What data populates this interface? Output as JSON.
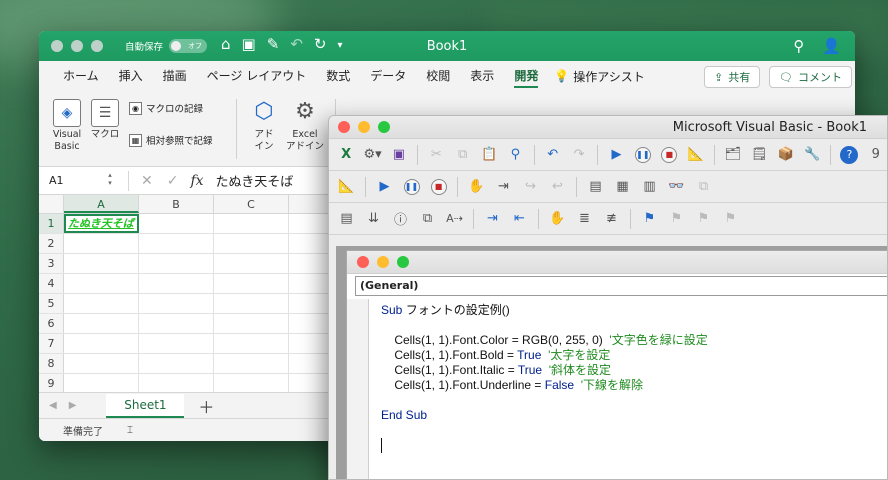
{
  "excel": {
    "title": "Book1",
    "autosave_label": "自動保存",
    "autosave_state": "オフ",
    "tabs": [
      "ホーム",
      "挿入",
      "描画",
      "ページ レイアウト",
      "数式",
      "データ",
      "校閲",
      "表示",
      "開発"
    ],
    "active_tab": "開発",
    "assist_label": "操作アシスト",
    "share_label": "共有",
    "comment_label": "コメント",
    "ribbon": {
      "visual_basic": "Visual\nBasic",
      "macro": "マクロ",
      "record_macro": "マクロの記録",
      "relative_ref": "相対参照で記録",
      "addins": "アド\nイン",
      "excel_addins": "Excel\nアドイン"
    },
    "name_box": "A1",
    "formula_fx": "fx",
    "formula_value": "たぬき天そば",
    "columns": [
      "A",
      "B",
      "C"
    ],
    "rows": [
      "1",
      "2",
      "3",
      "4",
      "5",
      "6",
      "7",
      "8",
      "9"
    ],
    "cell_a1": "たぬき天そば",
    "sheet_tab": "Sheet1",
    "status": "準備完了"
  },
  "vbe": {
    "title": "Microsoft Visual Basic - Book1",
    "toolbar_overflow": "9",
    "procedure_dropdown": "(General)",
    "code": {
      "l1_kw": "Sub",
      "l1_rest": " フォントの設定例()",
      "l3_code": "    Cells(1, 1).Font.Color = RGB(0, 255, 0)  ",
      "l3_comment": "'文字色を緑に設定",
      "l4_code": "    Cells(1, 1).Font.Bold = ",
      "l4_kw": "True",
      "l4_comment": "  '太字を設定",
      "l5_code": "    Cells(1, 1).Font.Italic = ",
      "l5_kw": "True",
      "l5_comment": "  '斜体を設定",
      "l6_code": "    Cells(1, 1).Font.Underline = ",
      "l6_kw": "False",
      "l6_comment": "  '下線を解除",
      "l8_kw": "End Sub"
    }
  },
  "colors": {
    "excel_green": "#1e9a60",
    "cell_text_green": "#22c322",
    "vba_keyword": "#00208c",
    "vba_comment": "#1f8a1f"
  }
}
